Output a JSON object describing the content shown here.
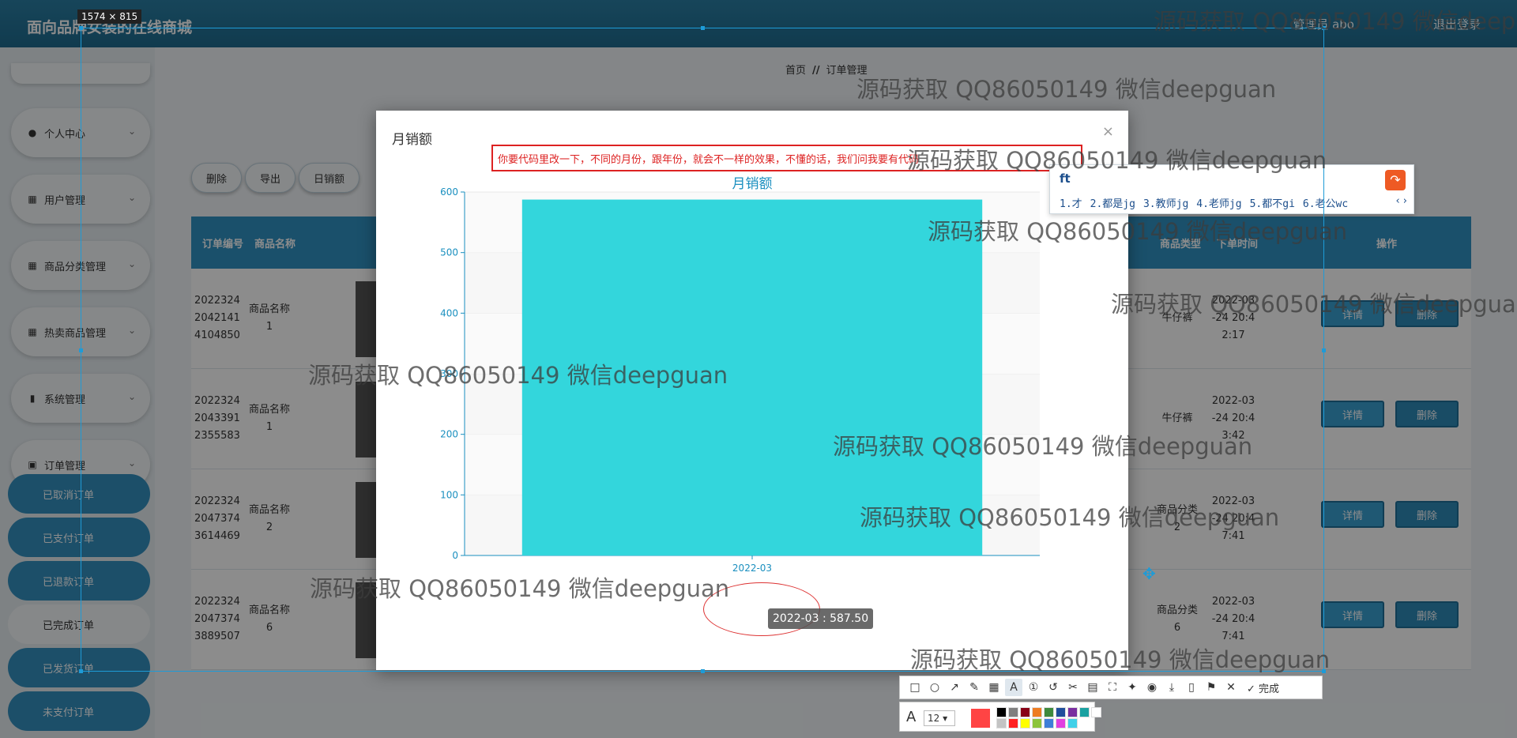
{
  "app": {
    "title": "面向品牌女装的在线商城",
    "user_label": "管理员 abo",
    "logout_label": "退出登录"
  },
  "sidebar": {
    "items": [
      {
        "label": "个人中心",
        "icon": "user-icon"
      },
      {
        "label": "用户管理",
        "icon": "grid-icon"
      },
      {
        "label": "商品分类管理",
        "icon": "grid-icon"
      },
      {
        "label": "热卖商品管理",
        "icon": "grid-icon"
      },
      {
        "label": "系统管理",
        "icon": "bar-icon"
      },
      {
        "label": "订单管理",
        "icon": "monitor-icon"
      }
    ],
    "subitems": [
      {
        "label": "已取消订单",
        "active": false
      },
      {
        "label": "已支付订单",
        "active": false
      },
      {
        "label": "已退款订单",
        "active": false
      },
      {
        "label": "已完成订单",
        "active": true
      },
      {
        "label": "已发货订单",
        "active": false
      },
      {
        "label": "未支付订单",
        "active": false
      }
    ]
  },
  "breadcrumb": {
    "home": "首页",
    "sep": "//",
    "current": "订单管理"
  },
  "toolbar": {
    "delete": "删除",
    "export": "导出",
    "daily_sales": "日销额"
  },
  "table": {
    "headers": {
      "order_no": "订单编号",
      "product_name": "商品名称",
      "product_type": "商品类型",
      "order_time": "下单时间",
      "actions": "操作"
    },
    "rows": [
      {
        "order_no": [
          "2022324",
          "2042141",
          "4104850"
        ],
        "product_name": [
          "商品名称",
          "1"
        ],
        "product_type": [
          "牛仔裤"
        ],
        "order_time": [
          "2022-03",
          "-24 20:4",
          "2:17"
        ]
      },
      {
        "order_no": [
          "2022324",
          "2043391",
          "2355583"
        ],
        "product_name": [
          "商品名称",
          "1"
        ],
        "product_type": [
          "牛仔裤"
        ],
        "order_time": [
          "2022-03",
          "-24 20:4",
          "3:42"
        ]
      },
      {
        "order_no": [
          "2022324",
          "2047374",
          "3614469"
        ],
        "product_name": [
          "商品名称",
          "2"
        ],
        "product_type": [
          "商品分类",
          "2"
        ],
        "order_time": [
          "2022-03",
          "-24 20:4",
          "7:41"
        ]
      },
      {
        "order_no": [
          "2022324",
          "2047374",
          "3889507"
        ],
        "product_name": [
          "商品名称",
          "6"
        ],
        "product_type": [
          "商品分类",
          "6"
        ],
        "order_time": [
          "2022-03",
          "-24 20:4",
          "7:41"
        ]
      }
    ],
    "detail_label": "详情",
    "delete_label": "删除"
  },
  "modal": {
    "title": "月销额",
    "close": "×",
    "notice": "你要代码里改一下，不同的月份，跟年份，就会不一样的效果，不懂的话，我们问我要有代码"
  },
  "chart_data": {
    "type": "bar",
    "title": "月销额",
    "categories": [
      "2022-03"
    ],
    "values": [
      587.5
    ],
    "ylim": [
      0,
      600
    ],
    "yticks": [
      0,
      100,
      200,
      300,
      400,
      500,
      600
    ],
    "bar_color": "#33d6dc",
    "axis_color": "#1a8fbf",
    "tooltip": "2022-03 : 587.50"
  },
  "ime": {
    "composition": "ft",
    "candidates": [
      "1.才",
      "2.都是jg",
      "3.教师jg",
      "4.老师jg",
      "5.都不gi",
      "6.老公wc"
    ],
    "prev": "‹",
    "next": "›"
  },
  "screenshot_tool": {
    "size_label": "1574 × 815",
    "done_label": "完成",
    "font_size": "12",
    "current_color": "#ff4444",
    "palette": [
      "#000000",
      "#7f7f7f",
      "#880015",
      "#ed7c22",
      "#3e8a3c",
      "#1f4e9c",
      "#7a2ea0",
      "#1aa1a1",
      "#ffffff",
      "#c3c3c3",
      "#ff2020",
      "#ffff00",
      "#8cc43c",
      "#3f7fd8",
      "#e040e0",
      "#40d0e8"
    ]
  },
  "watermark": "源码获取 QQ86050149 微信deepguan"
}
